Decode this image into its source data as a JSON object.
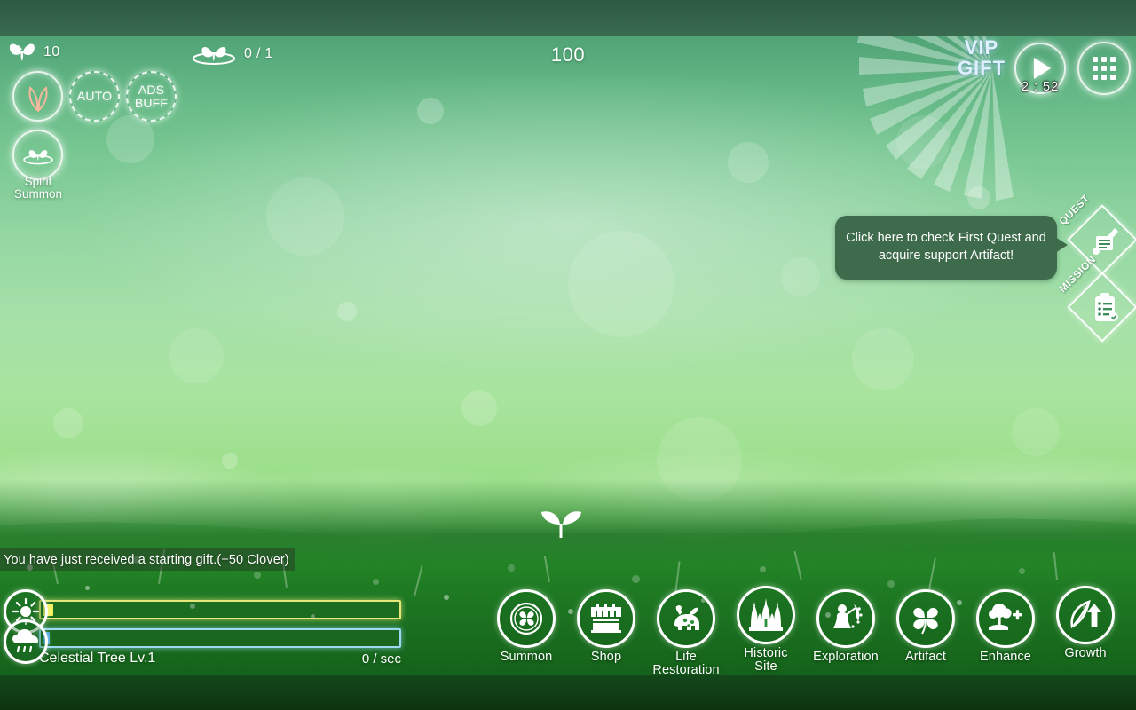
{
  "scene": {
    "bg_top_color": "#2d5943",
    "bg_sky_top": "#4fa376",
    "bg_sky_bottom": "#8fd97c",
    "bg_grass": "#1c7521",
    "letterbox_color": "#0f3d16"
  },
  "hud": {
    "currency_butterfly": {
      "icon": "butterfly-icon",
      "value": "10"
    },
    "currency_spirit": {
      "icon": "butterfly-ring-icon",
      "value": "0 / 1"
    },
    "center_counter": "100"
  },
  "left_buttons": [
    {
      "name": "leaf-button",
      "icon": "leaf-icon",
      "label": ""
    },
    {
      "name": "auto-button",
      "icon": "",
      "label": "AUTO"
    },
    {
      "name": "ads-buff-button",
      "icon": "",
      "label": "ADS\nBUFF"
    }
  ],
  "left_labels": {
    "auto": "AUTO",
    "ads_buff_line1": "ADS",
    "ads_buff_line2": "BUFF",
    "spirit_summon_line1": "Spirit",
    "spirit_summon_line2": "Summon"
  },
  "vip": {
    "line1": "VIP",
    "line2": "GIFT",
    "text_color": "#dff0ff"
  },
  "play": {
    "icon": "play-icon",
    "timer": "2 : 52"
  },
  "menu": {
    "icon": "grid-menu-icon"
  },
  "side_badges": [
    {
      "name": "quest-badge",
      "label": "QUEST",
      "icon": "scroll-pen-icon"
    },
    {
      "name": "mission-badge",
      "label": "MISSION",
      "icon": "clipboard-check-icon"
    }
  ],
  "tooltip": {
    "text": "Click here to check First Quest and acquire support Artifact!",
    "bg_color": "#3e6b4b"
  },
  "toast": {
    "text": "You have just received a starting gift.(+50 Clover)"
  },
  "resources": {
    "sun": {
      "icon": "sun-icon",
      "bar_color": "#f2ef5d",
      "border_color": "#e8e77a",
      "fill_percent": 3
    },
    "rain": {
      "icon": "rain-cloud-icon",
      "bar_color": "#4aa8e0",
      "border_color": "#9ed8f2",
      "fill_percent": 2
    },
    "tree_name": "Celestial Tree Lv.1",
    "rate": "0 / sec"
  },
  "bottom_nav": [
    {
      "name": "nav-summon",
      "label": "Summon",
      "icon": "clover-ring-icon"
    },
    {
      "name": "nav-shop",
      "label": "Shop",
      "icon": "shop-icon"
    },
    {
      "name": "nav-life-restoration",
      "label": "Life\nRestoration",
      "label1": "Life",
      "label2": "Restoration",
      "icon": "animal-icon"
    },
    {
      "name": "nav-historic-site",
      "label": "Historic\nSite",
      "label1": "Historic",
      "label2": "Site",
      "icon": "castle-icon"
    },
    {
      "name": "nav-exploration",
      "label": "Exploration",
      "icon": "explorer-icon"
    },
    {
      "name": "nav-artifact",
      "label": "Artifact",
      "icon": "four-leaf-clover-icon"
    },
    {
      "name": "nav-enhance",
      "label": "Enhance",
      "icon": "tree-plus-icon"
    },
    {
      "name": "nav-growth",
      "label": "Growth",
      "icon": "leaf-arrow-up-icon"
    }
  ]
}
